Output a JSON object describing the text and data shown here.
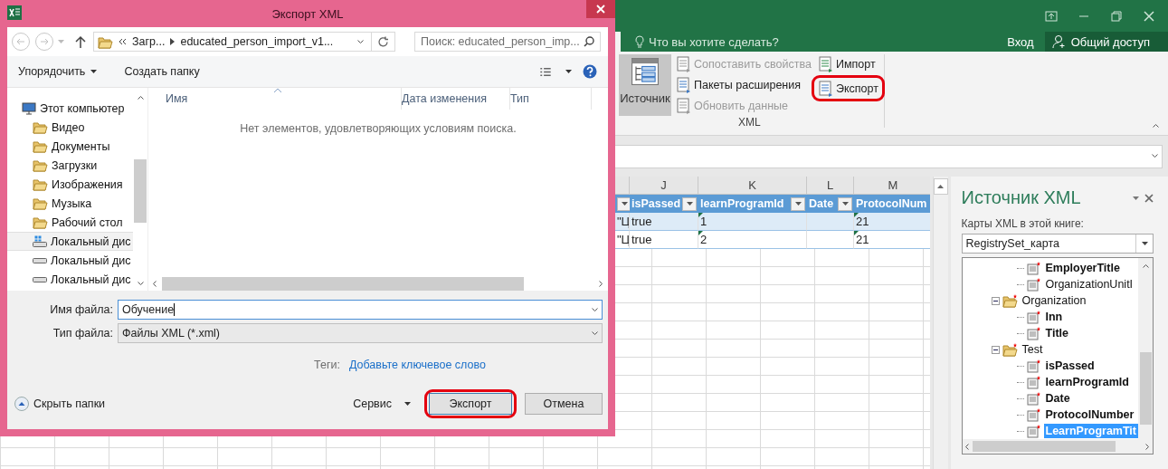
{
  "excel": {
    "search_prompt": "Что вы хотите сделать?",
    "sign_in": "Вход",
    "share": "Общий доступ",
    "ribbon": {
      "big_button": {
        "label": "Источник",
        "selected": true
      },
      "items": [
        {
          "label": "Сопоставить свойства",
          "kind": "map",
          "disabled": true,
          "highlighted": false
        },
        {
          "label": "Пакеты расширения",
          "kind": "packs",
          "disabled": false,
          "highlighted": false
        },
        {
          "label": "Обновить данные",
          "kind": "refresh",
          "disabled": true,
          "highlighted": false
        },
        {
          "label": "Импорт",
          "kind": "import",
          "disabled": false,
          "highlighted": false
        },
        {
          "label": "Экспорт",
          "kind": "export",
          "disabled": false,
          "highlighted": true
        }
      ],
      "group_label": "XML"
    },
    "sheet": {
      "columns": [
        "J",
        "K",
        "L",
        "M"
      ],
      "table_headers": [
        "isPassed",
        "learnProgramId",
        "Date",
        "ProtocolNum"
      ],
      "rows": [
        {
          "banded": true,
          "cells": [
            {
              "text": "\"Ц",
              "error_flag": false
            },
            {
              "text": "true",
              "error_flag": false
            },
            {
              "text": "1",
              "error_flag": true
            },
            {
              "text": null,
              "error_flag": false
            },
            {
              "text": "21",
              "error_flag": true
            }
          ]
        },
        {
          "banded": false,
          "cells": [
            {
              "text": "\"Ц",
              "error_flag": false
            },
            {
              "text": "true",
              "error_flag": false
            },
            {
              "text": "2",
              "error_flag": true
            },
            {
              "text": null,
              "error_flag": false
            },
            {
              "text": "21",
              "error_flag": true
            }
          ]
        }
      ]
    },
    "task_pane": {
      "title": "Источник XML",
      "maps_label": "Карты XML в этой книге:",
      "map": "RegistrySet_карта",
      "tree": [
        {
          "kind": "offscreen",
          "children": [
            {
              "kind": "element",
              "label": "EmployerTitle",
              "mapped": true,
              "selected": false
            },
            {
              "kind": "element",
              "label": "OrganizationUnitI",
              "mapped": false,
              "selected": false
            }
          ]
        },
        {
          "kind": "folder",
          "label": "Organization",
          "expanded": true,
          "mapped": false,
          "selected": false,
          "children": [
            {
              "kind": "element",
              "label": "Inn",
              "mapped": true,
              "selected": false
            },
            {
              "kind": "element",
              "label": "Title",
              "mapped": true,
              "selected": false
            }
          ]
        },
        {
          "kind": "folder",
          "label": "Test",
          "expanded": true,
          "mapped": false,
          "selected": false,
          "children": [
            {
              "kind": "element",
              "label": "isPassed",
              "mapped": true,
              "selected": false
            },
            {
              "kind": "element",
              "label": "learnProgramId",
              "mapped": true,
              "selected": false
            },
            {
              "kind": "element",
              "label": "Date",
              "mapped": true,
              "selected": false
            },
            {
              "kind": "element",
              "label": "ProtocolNumber",
              "mapped": true,
              "selected": false
            },
            {
              "kind": "element",
              "label": "LearnProgramTit",
              "mapped": true,
              "selected": true
            }
          ]
        }
      ]
    }
  },
  "dialog": {
    "title": "Экспорт XML",
    "path": [
      "Загр...",
      "educated_person_import_v1..."
    ],
    "search_placeholder": "Поиск: educated_person_imp...",
    "toolbar": {
      "organize": "Упорядочить",
      "new_folder": "Создать папку"
    },
    "nav": {
      "label": "Этот компьютер",
      "children": [
        {
          "label": "Видео",
          "kind": "folder",
          "selected": false
        },
        {
          "label": "Документы",
          "kind": "folder",
          "selected": false
        },
        {
          "label": "Загрузки",
          "kind": "folder",
          "selected": false
        },
        {
          "label": "Изображения",
          "kind": "folder",
          "selected": false
        },
        {
          "label": "Музыка",
          "kind": "folder",
          "selected": false
        },
        {
          "label": "Рабочий стол",
          "kind": "folder",
          "selected": false
        },
        {
          "label": "Локальный дис",
          "kind": "system_drive",
          "selected": true
        },
        {
          "label": "Локальный дис",
          "kind": "drive",
          "selected": false
        },
        {
          "label": "Локальный дис",
          "kind": "drive",
          "selected": false
        }
      ]
    },
    "columns": [
      "Имя",
      "Дата изменения",
      "Тип"
    ],
    "empty_message": "Нет элементов, удовлетворяющих условиям поиска.",
    "file_name": {
      "label": "Имя файла:",
      "value": "Обучение"
    },
    "file_type": {
      "label": "Тип файла:",
      "value": "Файлы XML (*.xml)"
    },
    "tags": {
      "label": "Теги:",
      "link": "Добавьте ключевое слово"
    },
    "hide_folders": "Скрыть папки",
    "tools": "Сервис",
    "buttons": [
      {
        "label": "Экспорт",
        "default": true,
        "highlighted": true
      },
      {
        "label": "Отмена",
        "default": false,
        "highlighted": false
      }
    ]
  }
}
